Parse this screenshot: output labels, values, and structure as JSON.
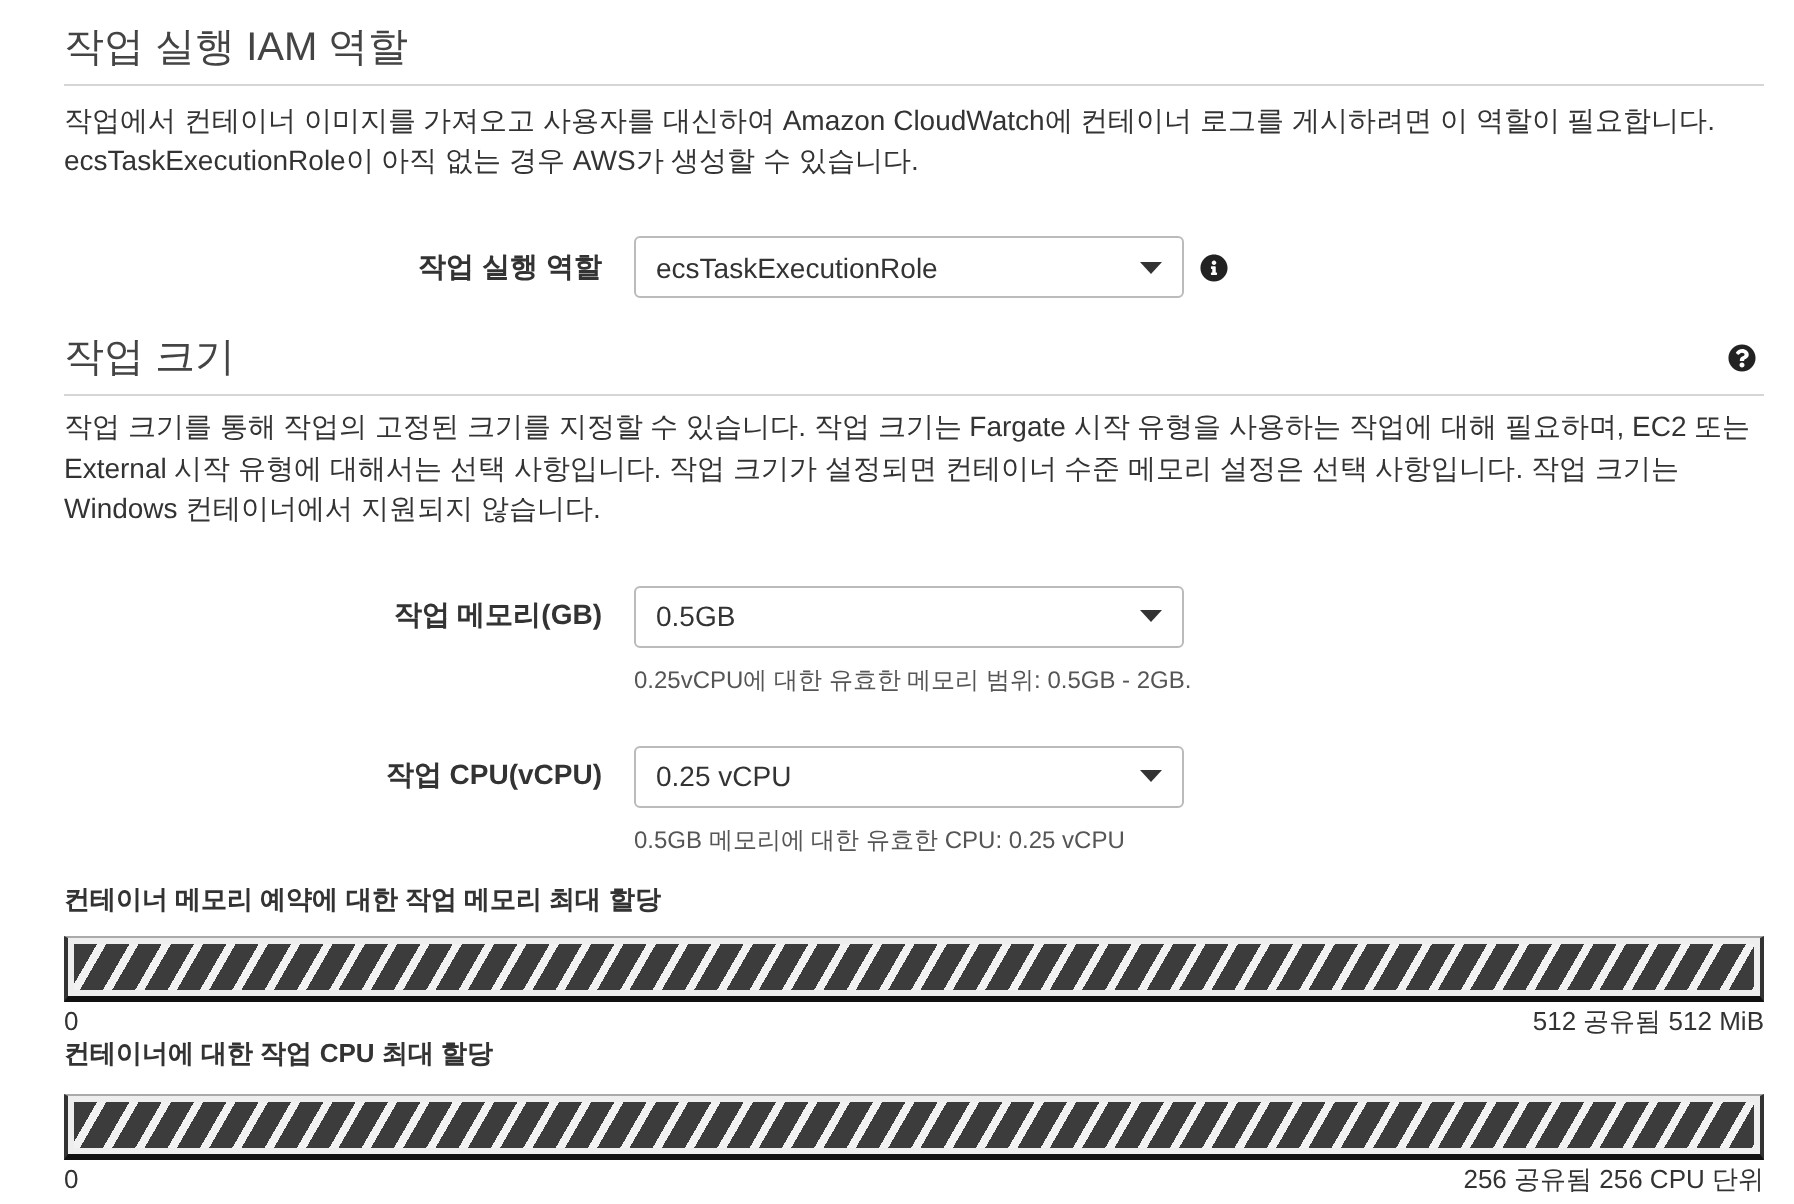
{
  "role_section": {
    "title": "작업 실행 IAM 역할",
    "description": "작업에서 컨테이너 이미지를 가져오고 사용자를 대신하여 Amazon CloudWatch에 컨테이너 로그를 게시하려면 이 역할이 필요합니다. ecsTaskExecutionRole이 아직 없는 경우 AWS가 생성할 수 있습니다.",
    "field": {
      "label": "작업 실행 역할",
      "value": "ecsTaskExecutionRole"
    }
  },
  "size_section": {
    "title": "작업 크기",
    "description": "작업 크기를 통해 작업의 고정된 크기를 지정할 수 있습니다. 작업 크기는 Fargate 시작 유형을 사용하는 작업에 대해 필요하며, EC2 또는 External 시작 유형에 대해서는 선택 사항입니다. 작업 크기가 설정되면 컨테이너 수준 메모리 설정은 선택 사항입니다. 작업 크기는 Windows 컨테이너에서 지원되지 않습니다.",
    "fields": [
      {
        "label": "작업 메모리(GB)",
        "value": "0.5GB",
        "hint": "0.25vCPU에 대한 유효한 메모리 범위: 0.5GB - 2GB."
      },
      {
        "label": "작업 CPU(vCPU)",
        "value": "0.25 vCPU",
        "hint": "0.5GB 메모리에 대한 유효한 CPU: 0.25 vCPU"
      }
    ]
  },
  "allocations": [
    {
      "title": "컨테이너 메모리 예약에 대한 작업 메모리 최대 할당",
      "level": 1,
      "min_label": "0",
      "max_label": "512 공유됨 512 MiB"
    },
    {
      "title": "컨테이너에 대한 작업 CPU 최대 할당",
      "level": 1,
      "min_label": "0",
      "max_label": "256 공유됨 256 CPU 단위"
    }
  ]
}
